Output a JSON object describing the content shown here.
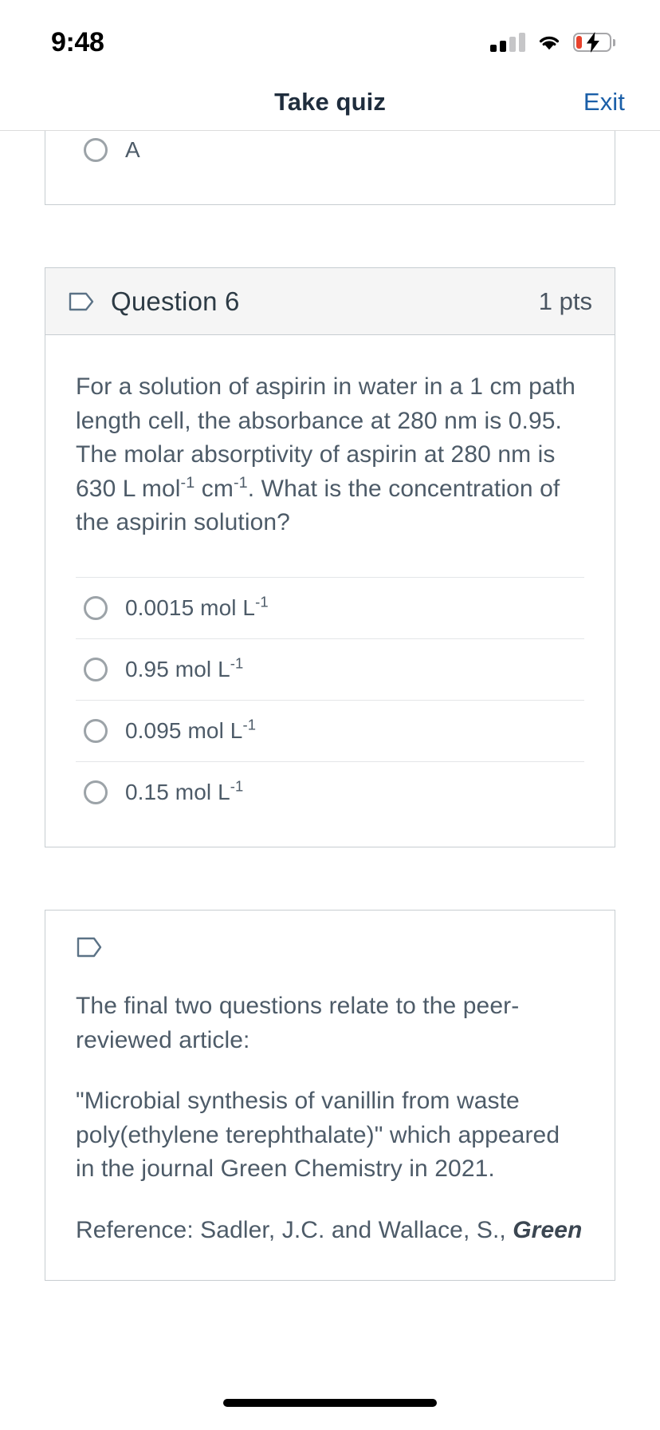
{
  "status_bar": {
    "time": "9:48",
    "signal_icon": "cellular-signal-icon",
    "signal_bars_filled": 2,
    "signal_bars_total": 4,
    "wifi_icon": "wifi-icon",
    "battery_icon": "battery-charging-icon",
    "battery_level_low": true,
    "battery_charging": true,
    "battery_fill_color": "#e8422c"
  },
  "nav": {
    "title": "Take quiz",
    "exit_label": "Exit",
    "link_color": "#1b5fa8"
  },
  "previous_question": {
    "clipped": true,
    "visible_options": [
      {
        "label": "A"
      }
    ]
  },
  "question": {
    "flag_icon": "question-flag-icon",
    "title": "Question 6",
    "points": "1 pts",
    "prompt_parts": [
      {
        "text": "For a solution of aspirin in water in a 1 cm path length cell, the absorbance at 280 nm is 0.95. The molar absorptivity of aspirin at 280 nm is 630 L mol"
      },
      {
        "sup": "-1"
      },
      {
        "text": " cm"
      },
      {
        "sup": "-1"
      },
      {
        "text": ". What is the concentration of the aspirin solution?"
      }
    ],
    "prompt_plain": "For a solution of aspirin in water in a 1 cm path length cell, the absorbance at 280 nm is 0.95. The molar absorptivity of aspirin at 280 nm is 630 L mol-1 cm-1. What is the concentration of the aspirin solution?",
    "options": [
      {
        "value": "0.0015",
        "unit": "mol L",
        "exponent": "-1",
        "selected": false
      },
      {
        "value": "0.95",
        "unit": "mol L",
        "exponent": "-1",
        "selected": false
      },
      {
        "value": "0.095",
        "unit": "mol L",
        "exponent": "-1",
        "selected": false
      },
      {
        "value": "0.15",
        "unit": "mol L",
        "exponent": "-1",
        "selected": false
      }
    ]
  },
  "info_block": {
    "flag_icon": "question-flag-icon",
    "paragraph_1": "The final two questions relate to the peer-reviewed article:",
    "paragraph_2": "\"Microbial synthesis of vanillin from waste poly(ethylene terephthalate)\" which appeared in the journal Green Chemistry in 2021.",
    "paragraph_3_prefix": "Reference: Sadler, J.C. and Wallace, S., ",
    "paragraph_3_emphasis": "Green"
  },
  "home_indicator": "home-indicator"
}
